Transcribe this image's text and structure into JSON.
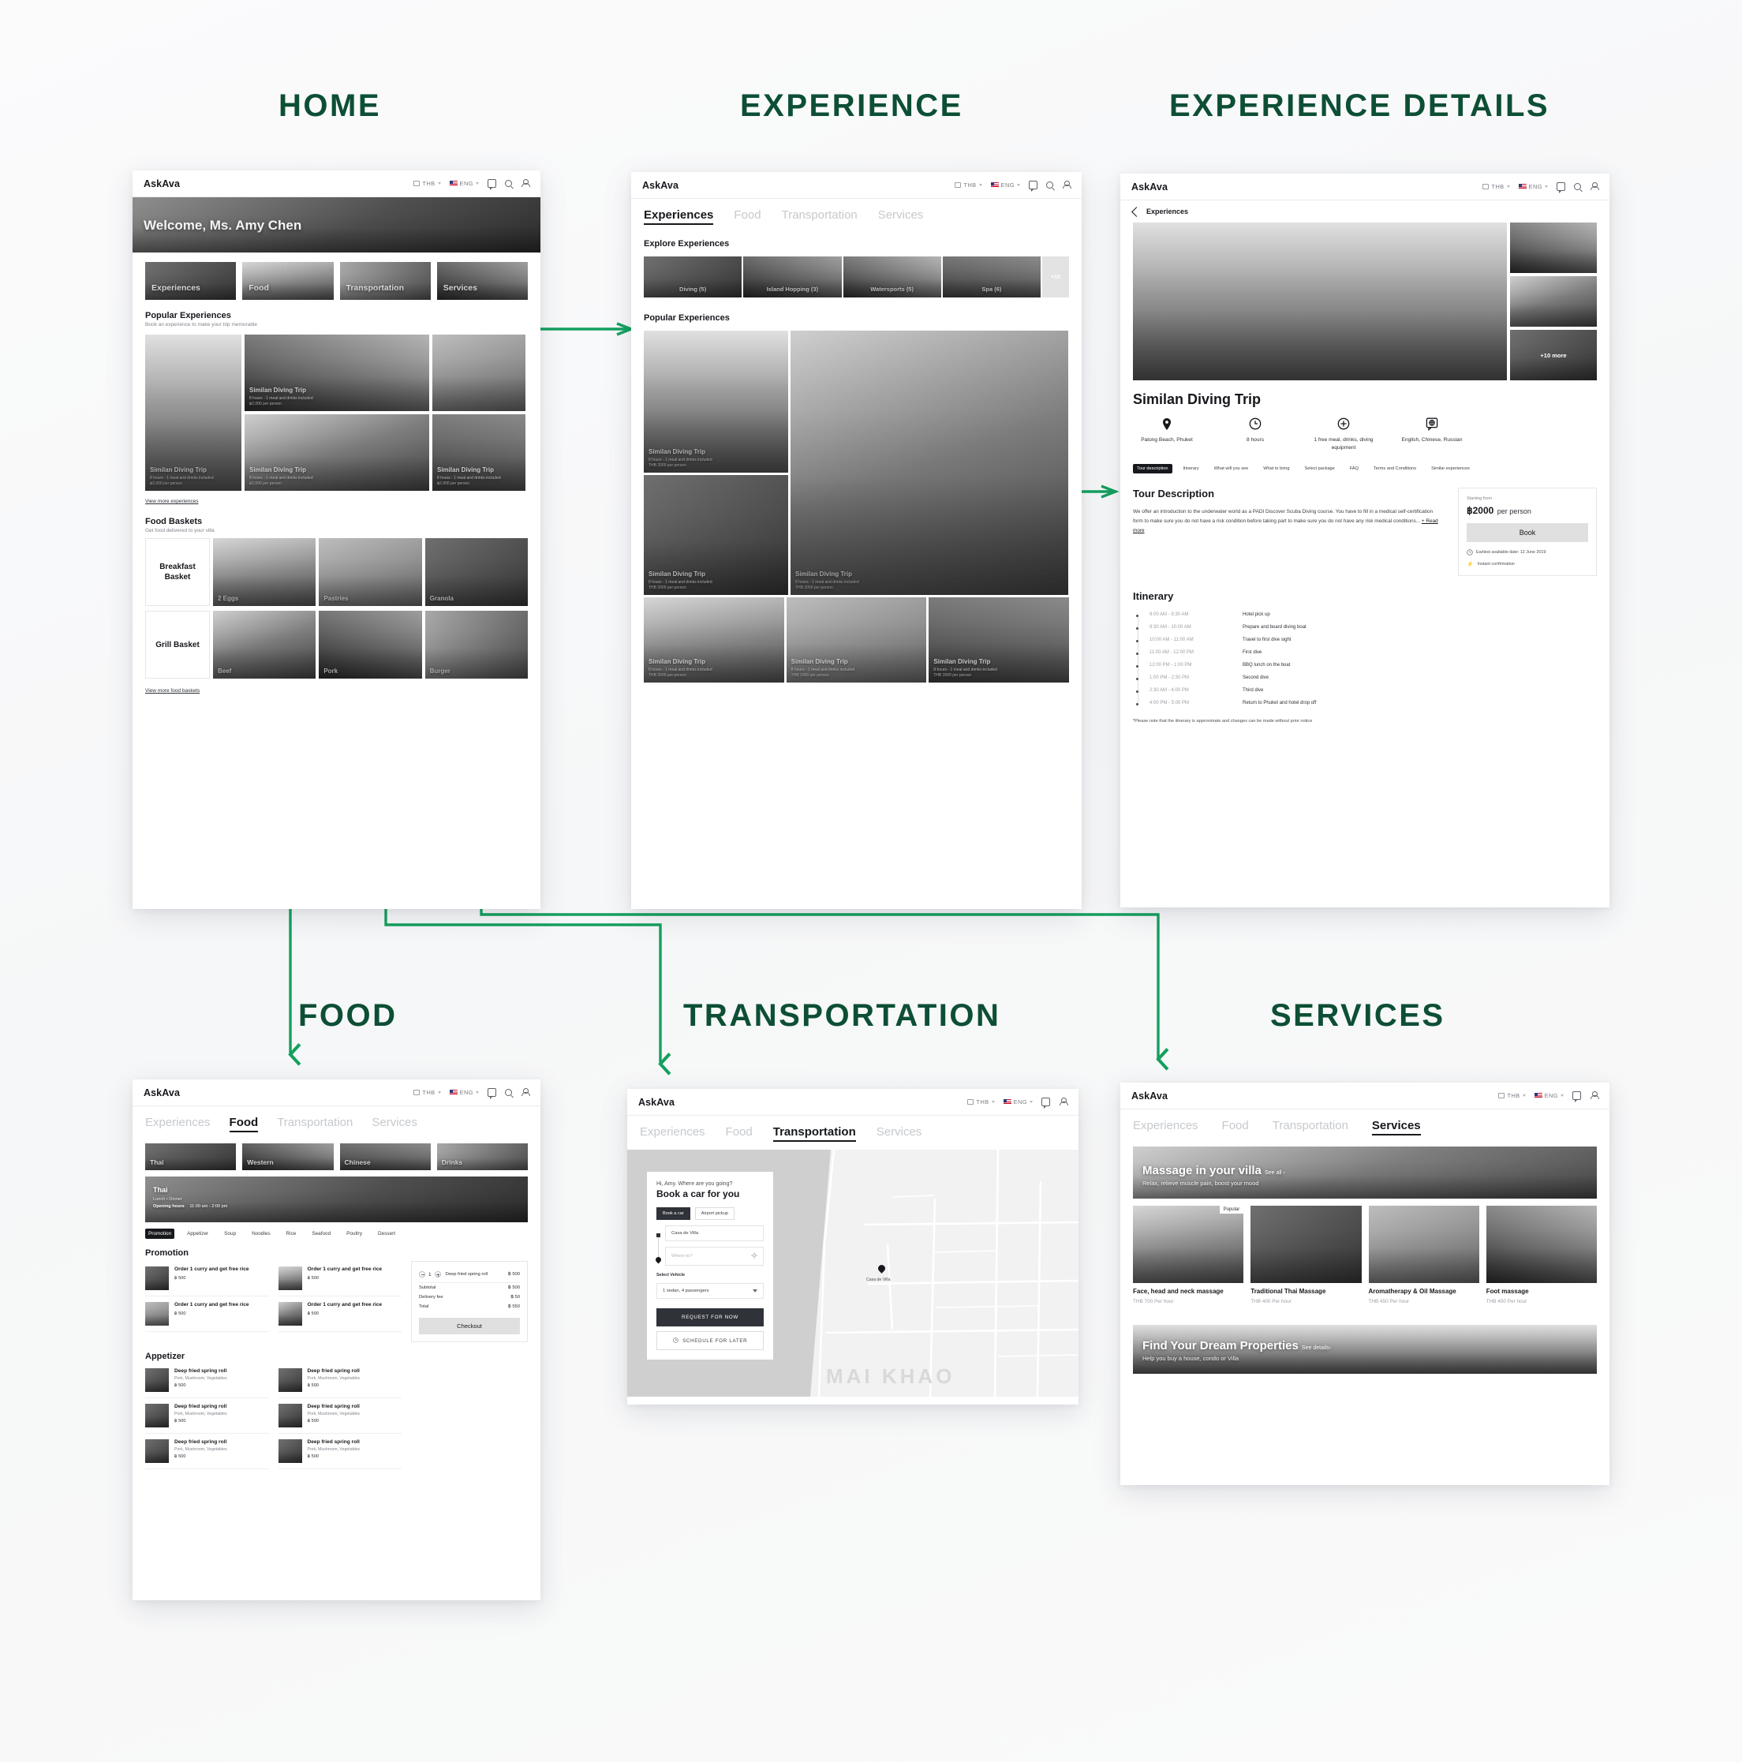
{
  "flow_titles": {
    "home": "HOME",
    "experience": "EXPERIENCE",
    "experience_details": "EXPERIENCE DETAILS",
    "food": "FOOD",
    "transportation": "TRANSPORTATION",
    "services": "SERVICES"
  },
  "accent_color": "#0d4f35",
  "connector_color": "#14a05e",
  "topbar": {
    "brand": "AskAva",
    "currency": "THB",
    "language": "ENG",
    "icons": [
      "chat-icon",
      "search-icon",
      "user-icon"
    ]
  },
  "nav_tabs": [
    "Experiences",
    "Food",
    "Transportation",
    "Services"
  ],
  "home": {
    "welcome": "Welcome, Ms. Amy Chen",
    "categories": [
      "Experiences",
      "Food",
      "Transportation",
      "Services"
    ],
    "popular": {
      "heading": "Popular Experiences",
      "sub": "Book an experience to make your trip memorable",
      "cards": [
        {
          "title": "Similan Diving Trip",
          "line1": "8 hours - 1 meal and drinks included",
          "line2": "฿2,000 per person"
        },
        {
          "title": "Similan Diving Trip",
          "line1": "8 hours - 1 meal and drinks included",
          "line2": "฿2,000 per person"
        },
        {
          "title": "Similan Diving Trip",
          "line1": "8 hours - 1 meal and drinks included",
          "line2": "฿2,000 per person"
        },
        {
          "title": "Similan Diving Trip",
          "line1": "8 hours - 1 meal and drinks included",
          "line2": "฿2,000 per person"
        }
      ],
      "view_more": "View more experiences"
    },
    "baskets": {
      "heading": "Food Baskets",
      "sub": "Get food delivered to your villa",
      "rows": [
        {
          "name": "Breakfast Basket",
          "items": [
            "2 Eggs",
            "Pastries",
            "Granola"
          ]
        },
        {
          "name": "Grill Basket",
          "items": [
            "Beef",
            "Pork",
            "Burger"
          ]
        }
      ],
      "view_more": "View more food baskets"
    }
  },
  "experience": {
    "active_tab": "Experiences",
    "explore": {
      "heading": "Explore Experiences",
      "tiles": [
        "Diving (5)",
        "Island Hopping (3)",
        "Watersports (5)",
        "Spa (6)"
      ],
      "more": "+10"
    },
    "popular": {
      "heading": "Popular Experiences",
      "cards": [
        {
          "title": "Similan Diving Trip",
          "line1": "8 hours - 1 meal and drinks included",
          "line2": "THB 2000 per person"
        },
        {
          "title": "Similan Diving Trip",
          "line1": "8 hours - 1 meal and drinks included",
          "line2": "THB 2000 per person"
        },
        {
          "title": "Similan Diving Trip",
          "line1": "8 hours - 1 meal and drinks included",
          "line2": "THB 2000 per person"
        },
        {
          "title": "Similan Diving Trip",
          "line1": "8 hours - 1 meal and drinks included",
          "line2": "THB 2000 per person"
        },
        {
          "title": "Similan Diving Trip",
          "line1": "8 hours - 1 meal and drinks included",
          "line2": "THB 2000 per person"
        },
        {
          "title": "Similan Diving Trip",
          "line1": "8 hours - 1 meal and drinks included",
          "line2": "THB 2000 per person"
        }
      ]
    }
  },
  "details": {
    "back_label": "Experiences",
    "gallery_more": "+10 more",
    "title": "Similan Diving Trip",
    "meta": [
      {
        "icon": "location-pin-icon",
        "text": "Patong Beach, Phuket"
      },
      {
        "icon": "clock-icon",
        "text": "8 hours"
      },
      {
        "icon": "plus-circle-icon",
        "text": "1 free meal, drinks, diving equipment"
      },
      {
        "icon": "language-globe-icon",
        "text": "English, Chinese, Russian"
      }
    ],
    "pills": [
      "Tour description",
      "Itinerary",
      "What will you see",
      "What to bring",
      "Select package",
      "FAQ",
      "Terms and Conditions",
      "Similar experiences"
    ],
    "active_pill": "Tour description",
    "tour_description": {
      "heading": "Tour Description",
      "body": "We offer an introduction to the underwater world as a PADI Discover Scuba Diving course. You have to fill in a medical self-certification form to make sure you do not have a risk condition before taking part to make sure you do not have any risk medical conditions...",
      "read_more": "+ Read more"
    },
    "booking": {
      "starting_from": "Starting from",
      "price": "฿2000",
      "price_unit": "per person",
      "book_label": "Book",
      "earliest": "Earliest available date: 12 June 2019",
      "instant": "Instant confirmation"
    },
    "itinerary": {
      "heading": "Itinerary",
      "rows": [
        {
          "time": "9:00 AM - 9:30 AM",
          "activity": "Hotel pick up"
        },
        {
          "time": "9:30 AM - 10:00 AM",
          "activity": "Prepare and board diving boat"
        },
        {
          "time": "10:00 AM - 11:00 AM",
          "activity": "Travel to first dive sight"
        },
        {
          "time": "11:00 AM - 12:00 PM",
          "activity": "First dive"
        },
        {
          "time": "12:00 PM - 1:00 PM",
          "activity": "BBQ lunch on the boat"
        },
        {
          "time": "1:00 PM - 2:30 PM",
          "activity": "Second dive"
        },
        {
          "time": "2:30 AM - 4:00 PM",
          "activity": "Third dive"
        },
        {
          "time": "4:00 PM - 5:00 PM",
          "activity": "Return to Phuket and hotel drop off"
        }
      ],
      "note": "*Please note that the itinerary is approximate and changes can be made without prior notice"
    }
  },
  "food": {
    "active_tab": "Food",
    "categories": [
      "Thai",
      "Western",
      "Chinese",
      "Drinks"
    ],
    "banner": {
      "title": "Thai",
      "meals": "Lunch • Dinner",
      "hours_label": "Opening hours",
      "hours_value": "11:00 am - 2:00 pm"
    },
    "subtabs": [
      "Promotion",
      "Appetizer",
      "Soup",
      "Noodles",
      "Rice",
      "Seafood",
      "Poultry",
      "Dessert"
    ],
    "active_subtab": "Promotion",
    "promotion": {
      "heading": "Promotion",
      "items": [
        {
          "title": "Order 1 curry and get free rice",
          "price": "฿ 500"
        },
        {
          "title": "Order 1 curry and get free rice",
          "price": "฿ 500"
        },
        {
          "title": "Order 1 curry and get free rice",
          "price": "฿ 500"
        },
        {
          "title": "Order 1 curry and get free rice",
          "price": "฿ 500"
        }
      ]
    },
    "appetizer": {
      "heading": "Appetizer",
      "items": [
        {
          "title": "Deep fried spring roll",
          "desc": "Pork, Mushroom, Vegetables",
          "price": "฿ 500"
        },
        {
          "title": "Deep fried spring roll",
          "desc": "Pork, Mushroom, Vegetables",
          "price": "฿ 500"
        },
        {
          "title": "Deep fried spring roll",
          "desc": "Pork, Mushroom, Vegetables",
          "price": "฿ 500"
        },
        {
          "title": "Deep fried spring roll",
          "desc": "Pork, Mushroom, Vegetables",
          "price": "฿ 500"
        },
        {
          "title": "Deep fried spring roll",
          "desc": "Pork, Mushroom, Vegetables",
          "price": "฿ 500"
        },
        {
          "title": "Deep fried spring roll",
          "desc": "Pork, Mushroom, Vegetables",
          "price": "฿ 500"
        }
      ]
    },
    "cart": {
      "qty": "1",
      "item": "Deep fried spring roll",
      "item_price": "฿ 500",
      "subtotal_label": "Subtotal",
      "subtotal_value": "฿ 500",
      "delivery_label": "Delivery fee",
      "delivery_value": "฿ 50",
      "total_label": "Total",
      "total_value": "฿ 550",
      "checkout": "Checkout"
    }
  },
  "transportation": {
    "active_tab": "Transportation",
    "greeting": "Hi, Amy. Where are you going?",
    "heading": "Book a car for you",
    "segments": [
      "Book a car",
      "Airport pickup"
    ],
    "active_segment": "Book a car",
    "pickup_value": "Casa de Villa",
    "dropoff_placeholder": "Where to?",
    "vehicle_label": "Select Vehicle",
    "vehicle_value": "1 sedan, 4 passengers",
    "request_now": "REQUEST FOR NOW",
    "schedule_later": "SCHEDULE FOR LATER",
    "map_pin_label": "Casa de Villa",
    "map_word": "MAI KHAO"
  },
  "services": {
    "active_tab": "Services",
    "banner": {
      "title": "Massage in your villa",
      "see_all": "See all ›",
      "sub": "Relax, relieve muscle pain, boost your mood"
    },
    "cards": [
      {
        "badge": "Popular",
        "title": "Face, head and neck massage",
        "price": "THB 700",
        "unit": "Per hour"
      },
      {
        "badge": "",
        "title": "Traditional Thai Massage",
        "price": "THB 400",
        "unit": "Per hour"
      },
      {
        "badge": "",
        "title": "Aromatherapy & Oil Massage",
        "price": "THB 450",
        "unit": "Per hour"
      },
      {
        "badge": "",
        "title": "Foot massage",
        "price": "THB 450",
        "unit": "Per hour"
      }
    ],
    "promo": {
      "title": "Find Your Dream Properties",
      "see_details": "See details›",
      "sub": "Help you buy a house, condo or Villa"
    }
  }
}
